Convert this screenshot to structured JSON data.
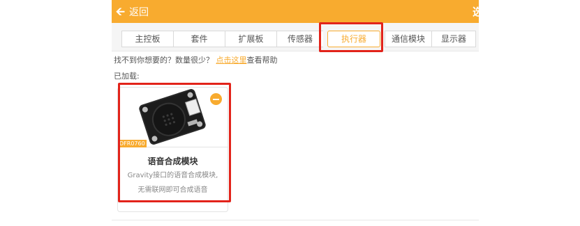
{
  "topbar": {
    "back_label": "返回",
    "right_label": "选"
  },
  "tabs": [
    {
      "label": "主控板"
    },
    {
      "label": "套件"
    },
    {
      "label": "扩展板"
    },
    {
      "label": "传感器"
    },
    {
      "label": "执行器"
    },
    {
      "label": "通信模块"
    },
    {
      "label": "显示器"
    }
  ],
  "help": {
    "prefix": "找不到你想要的？数量很少？",
    "link": "点击这里",
    "suffix": "查看帮助"
  },
  "loaded_label": "已加载:",
  "card": {
    "sku": "DFR0760",
    "title": "语音合成模块",
    "desc_line1": "Gravity接口的语音合成模块,",
    "desc_line2": "无需联网即可合成语音"
  },
  "colors": {
    "accent": "#f8ab2f",
    "highlight": "#e2231a"
  }
}
